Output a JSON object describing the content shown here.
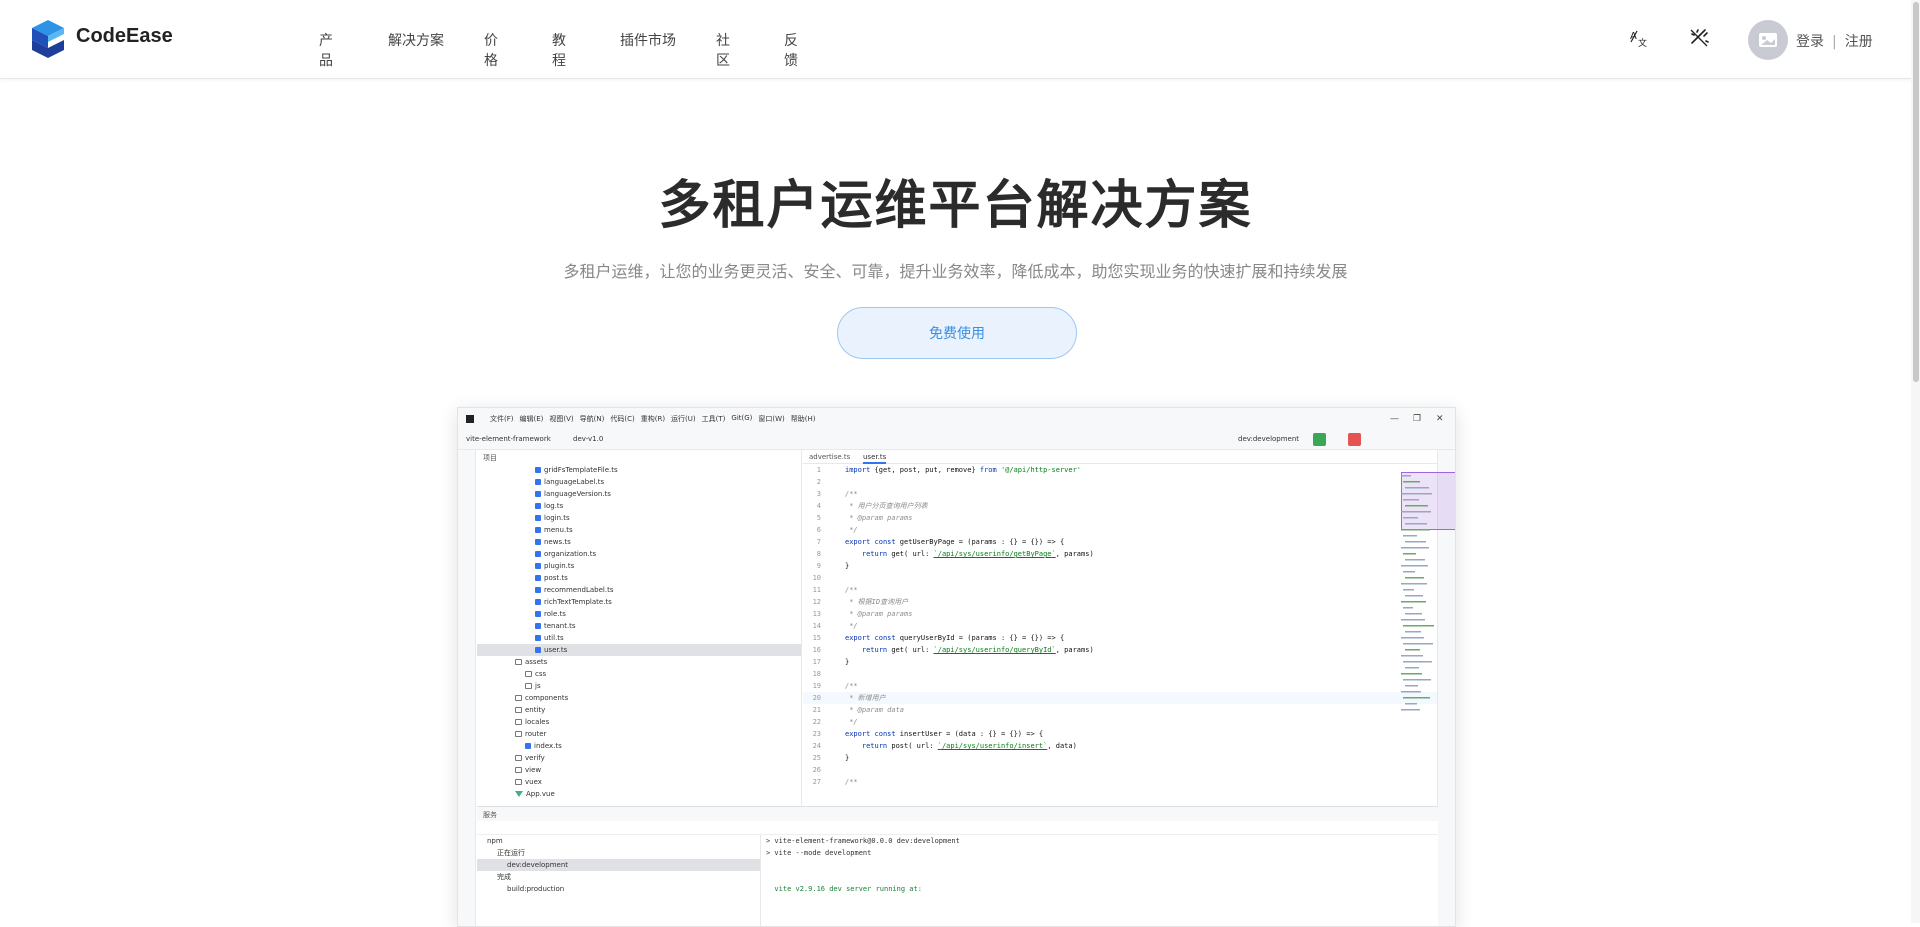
{
  "brand": {
    "name": "CodeEase"
  },
  "nav": {
    "items": [
      "产品",
      "解决方案",
      "价格",
      "教程",
      "插件市场",
      "社区",
      "反馈"
    ],
    "login": "登录",
    "separator": "|",
    "register": "注册"
  },
  "hero": {
    "title": "多租户运维平台解决方案",
    "subtitle": "多租户运维，让您的业务更灵活、安全、可靠，提升业务效率，降低成本，助您实现业务的快速扩展和持续发展",
    "cta": "免费使用"
  },
  "ide": {
    "menu": [
      "文件(F)",
      "编辑(E)",
      "视图(V)",
      "导航(N)",
      "代码(C)",
      "重构(R)",
      "运行(U)",
      "工具(T)",
      "Git(G)",
      "窗口(W)",
      "帮助(H)"
    ],
    "project": "vite-element-framework",
    "branch": "dev-v1.0",
    "run_config": "dev:development",
    "tree_header": "项目",
    "tree": [
      {
        "name": "gridFsTemplateFile.ts",
        "type": "file",
        "indent": 5
      },
      {
        "name": "languageLabel.ts",
        "type": "file",
        "indent": 5
      },
      {
        "name": "languageVersion.ts",
        "type": "file",
        "indent": 5
      },
      {
        "name": "log.ts",
        "type": "file",
        "indent": 5
      },
      {
        "name": "login.ts",
        "type": "file",
        "indent": 5
      },
      {
        "name": "menu.ts",
        "type": "file",
        "indent": 5
      },
      {
        "name": "news.ts",
        "type": "file",
        "indent": 5
      },
      {
        "name": "organization.ts",
        "type": "file",
        "indent": 5
      },
      {
        "name": "plugin.ts",
        "type": "file",
        "indent": 5
      },
      {
        "name": "post.ts",
        "type": "file",
        "indent": 5
      },
      {
        "name": "recommendLabel.ts",
        "type": "file",
        "indent": 5
      },
      {
        "name": "richTextTemplate.ts",
        "type": "file",
        "indent": 5
      },
      {
        "name": "role.ts",
        "type": "file",
        "indent": 5
      },
      {
        "name": "tenant.ts",
        "type": "file",
        "indent": 5
      },
      {
        "name": "util.ts",
        "type": "file",
        "indent": 5
      },
      {
        "name": "user.ts",
        "type": "file",
        "indent": 5,
        "selected": true
      },
      {
        "name": "assets",
        "type": "dir",
        "indent": 3,
        "open": true
      },
      {
        "name": "css",
        "type": "dir",
        "indent": 4
      },
      {
        "name": "js",
        "type": "dir",
        "indent": 4
      },
      {
        "name": "components",
        "type": "dir",
        "indent": 3
      },
      {
        "name": "entity",
        "type": "dir",
        "indent": 3
      },
      {
        "name": "locales",
        "type": "dir",
        "indent": 3
      },
      {
        "name": "router",
        "type": "dir",
        "indent": 3,
        "open": true
      },
      {
        "name": "index.ts",
        "type": "file",
        "indent": 4
      },
      {
        "name": "verify",
        "type": "dir",
        "indent": 3
      },
      {
        "name": "view",
        "type": "dir",
        "indent": 3
      },
      {
        "name": "vuex",
        "type": "dir",
        "indent": 3
      },
      {
        "name": "App.vue",
        "type": "vue",
        "indent": 3
      }
    ],
    "tabs": [
      "advertise.ts",
      "user.ts"
    ],
    "code": [
      "import {get, post, put, remove} from '@/api/http-server'",
      "",
      "/**",
      " * 用户分页查询用户列表",
      " * @param params",
      " */",
      "export const getUserByPage = (params : {} = {}) => {",
      "    return get( url: `/api/sys/userinfo/getByPage`, params)",
      "}",
      "",
      "/**",
      " * 根据ID查询用户",
      " * @param params",
      " */",
      "export const queryUserById = (params : {} = {}) => {",
      "    return get( url: `/api/sys/userinfo/queryById`, params)",
      "}",
      "",
      "/**",
      " * 新增用户",
      " * @param data",
      " */",
      "export const insertUser = (data : {} = {}) => {",
      "    return post( url: `/api/sys/userinfo/insert`, data)",
      "}",
      "",
      "/**"
    ],
    "bottom_title": "服务",
    "npm_tree": [
      {
        "label": "npm",
        "indent": 0
      },
      {
        "label": "正在运行",
        "indent": 1
      },
      {
        "label": "dev:development",
        "indent": 2,
        "selected": true
      },
      {
        "label": "完成",
        "indent": 1
      },
      {
        "label": "build:production",
        "indent": 2
      }
    ],
    "terminal": [
      "> vite-element-framework@0.0.0 dev:development",
      "> vite --mode development",
      "",
      "",
      "  vite v2.9.16 dev server running at:"
    ]
  },
  "colors": {
    "accent": "#3d8fe0",
    "cta_bg": "#eaf3fd",
    "cta_border": "#9cc8f3",
    "logo_dark": "#1f4fb8",
    "logo_light": "#2d93e6"
  }
}
